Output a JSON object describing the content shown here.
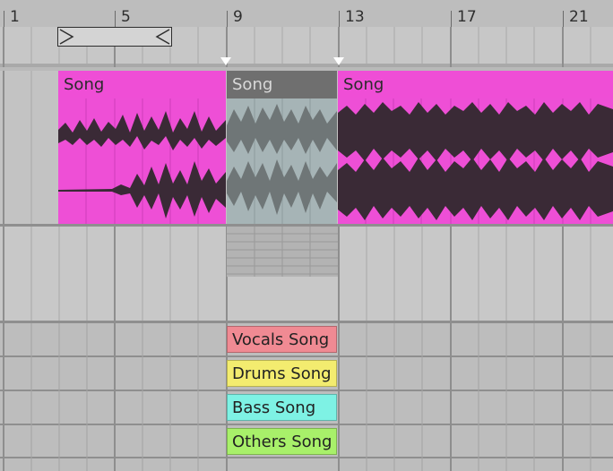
{
  "ruler": {
    "bars": [
      "1",
      "5",
      "9",
      "13",
      "17",
      "21"
    ]
  },
  "clips": {
    "left_title": "Song",
    "selected_title": "Song",
    "right_title": "Song"
  },
  "stems": [
    {
      "label": "Vocals Song",
      "color": "#f08a93"
    },
    {
      "label": "Drums Song",
      "color": "#f3ec6f"
    },
    {
      "label": "Bass Song",
      "color": "#7ef2e4"
    },
    {
      "label": "Others Song",
      "color": "#a8f06a"
    }
  ],
  "colors": {
    "clip_pink": "#ee4fd6",
    "selection": "#a6b4b6",
    "waveform": "#3a2a36"
  }
}
